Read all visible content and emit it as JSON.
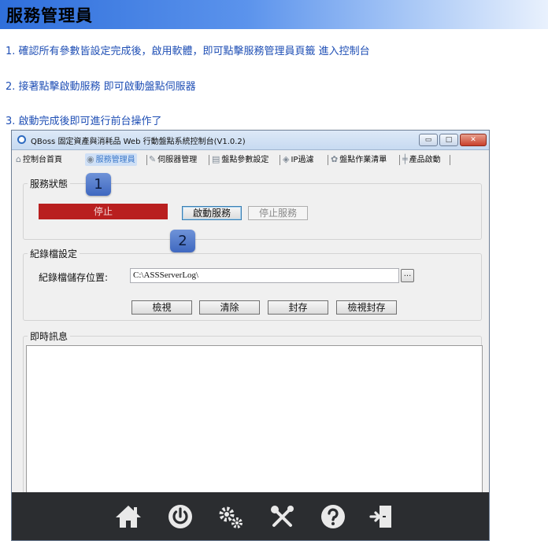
{
  "page": {
    "title": "服務管理員",
    "steps": [
      "1. 確認所有參數皆設定完成後，啟用軟體，即可點擊服務管理員頁籤 進入控制台",
      "2. 接著點擊啟動服務 即可啟動盤點伺服器",
      "3. 啟動完成後即可進行前台操作了"
    ]
  },
  "window": {
    "title": "QBoss 固定資產與消耗品 Web 行動盤點系統控制台(V1.0.2)",
    "controls": {
      "minimize": "▭",
      "maximize": "□",
      "close": "✕"
    }
  },
  "menu": [
    {
      "label": "控制台首頁",
      "icon": "home-icon"
    },
    {
      "label": "服務管理員",
      "icon": "service-icon",
      "active": true
    },
    {
      "label": "伺服器管理",
      "icon": "wrench-icon"
    },
    {
      "label": "盤點參數設定",
      "icon": "list-icon"
    },
    {
      "label": "IP過濾",
      "icon": "shield-icon"
    },
    {
      "label": "盤點作業清單",
      "icon": "gear-icon"
    },
    {
      "label": "產品啟動",
      "icon": "sliders-icon"
    }
  ],
  "service_status": {
    "group_label": "服務狀態",
    "status_text": "停止",
    "status_color": "#b91f1f",
    "start_button": "啟動服務",
    "stop_button": "停止服務"
  },
  "callouts": {
    "one": "1",
    "two": "2"
  },
  "log_settings": {
    "group_label": "紀錄檔設定",
    "path_label": "紀錄檔儲存位置:",
    "path_value": "C:\\ASSServerLog\\",
    "browse_label": "...",
    "buttons": {
      "view": "檢視",
      "clear": "清除",
      "archive": "封存",
      "view_archive": "檢視封存"
    }
  },
  "realtime": {
    "group_label": "即時訊息"
  },
  "dock": [
    "home-icon",
    "power-icon",
    "gears-icon",
    "tools-icon",
    "help-icon",
    "exit-icon"
  ]
}
